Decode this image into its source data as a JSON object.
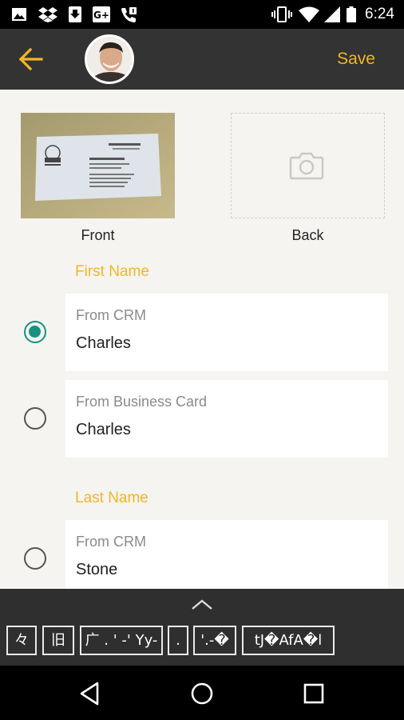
{
  "status_bar": {
    "time": "6:24",
    "left_icons": [
      "image-icon",
      "dropbox-icon",
      "download-icon",
      "google-plus-icon",
      "missed-call-icon"
    ],
    "right_icons": [
      "vibrate-icon",
      "wifi-icon",
      "cellular-signal-icon",
      "battery-icon"
    ]
  },
  "app_bar": {
    "save_label": "Save"
  },
  "business_card": {
    "front_label": "Front",
    "back_label": "Back"
  },
  "sections": [
    {
      "label": "First Name",
      "options": [
        {
          "source": "From CRM",
          "value": "Charles",
          "selected": true
        },
        {
          "source": "From Business Card",
          "value": "Charles",
          "selected": false
        }
      ]
    },
    {
      "label": "Last Name",
      "options": [
        {
          "source": "From CRM",
          "value": "Stone",
          "selected": false
        }
      ]
    }
  ],
  "keyboard_suggestions": [
    "々",
    "旧",
    "广 . ' -' Yy-",
    ".",
    "'.-�",
    "tJ�AfA�l"
  ],
  "colors": {
    "accent": "#f2b623",
    "radio_selected": "#17927f",
    "app_bar": "#333333",
    "background": "#f5f4f1"
  }
}
